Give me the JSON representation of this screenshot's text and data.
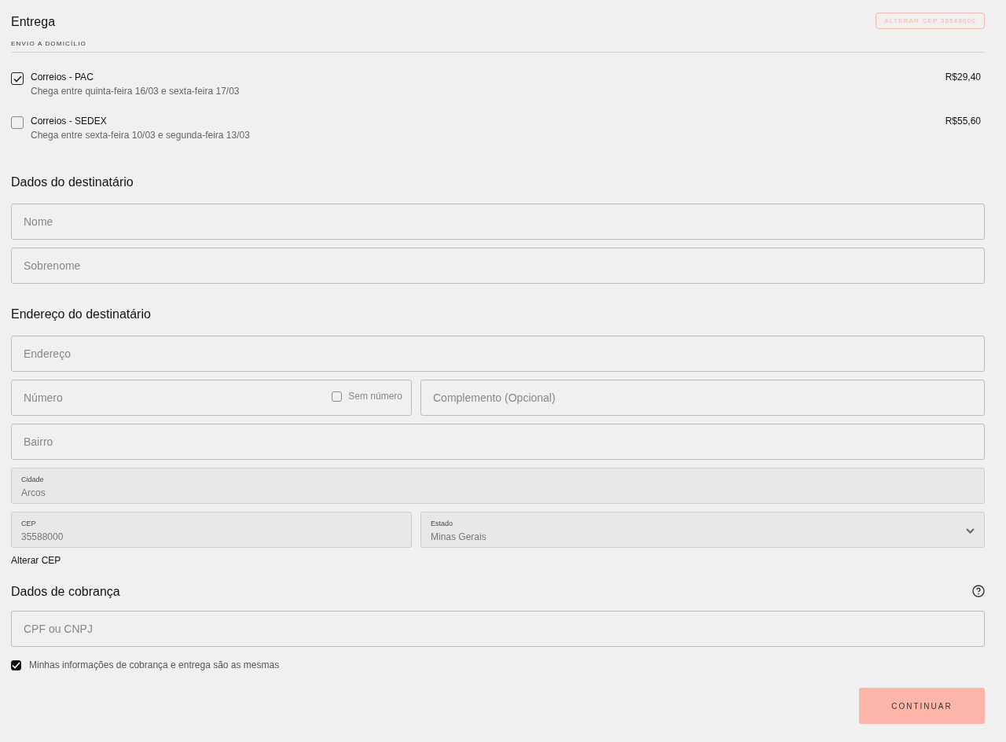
{
  "delivery": {
    "title": "Entrega",
    "change_button": "ALTERAR CEP 35588000",
    "subtitle": "ENVIO A DOMICÍLIO",
    "options": [
      {
        "name": "Correios - PAC",
        "eta": "Chega entre quinta-feira 16/03 e sexta-feira 17/03",
        "price": "R$29,40",
        "selected": true
      },
      {
        "name": "Correios - SEDEX",
        "eta": "Chega entre sexta-feira 10/03 e segunda-feira 13/03",
        "price": "R$55,60",
        "selected": false
      }
    ]
  },
  "recipient": {
    "title": "Dados do destinatário",
    "fields": [
      {
        "placeholder": "Nome"
      },
      {
        "placeholder": "Sobrenome"
      }
    ]
  },
  "address": {
    "title": "Endereço do destinatário",
    "rows": [
      [
        {
          "kind": "text",
          "placeholder": "Endereço"
        }
      ],
      [
        {
          "kind": "number",
          "placeholder": "Número",
          "checkbox_label": "Sem número",
          "checked": false
        },
        {
          "kind": "text",
          "placeholder": "Complemento (Opcional)"
        }
      ],
      [
        {
          "kind": "text",
          "placeholder": "Bairro"
        }
      ],
      [
        {
          "kind": "filled",
          "label": "Cidade",
          "value": "Arcos"
        }
      ],
      [
        {
          "kind": "filled",
          "label": "CEP",
          "value": "35588000"
        },
        {
          "kind": "select",
          "label": "Estado",
          "value": "Minas Gerais"
        }
      ]
    ],
    "link": "Alterar CEP"
  },
  "billing": {
    "title": "Dados de cobrança",
    "field": {
      "placeholder": "CPF ou CNPJ"
    },
    "same_info": {
      "label": "Minhas informações de cobrança e entrega são as mesmas",
      "checked": true
    },
    "continue_button": "CONTINUAR"
  }
}
